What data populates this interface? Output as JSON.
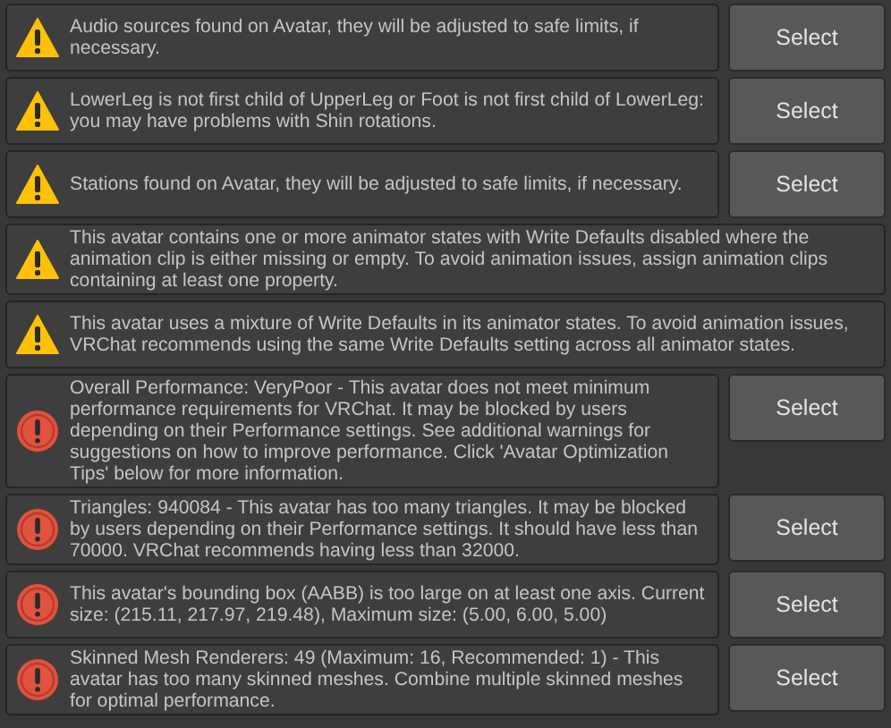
{
  "messages": [
    {
      "kind": "warning",
      "text": "Audio sources found on Avatar, they will be adjusted to safe limits, if necessary.",
      "button": "Select"
    },
    {
      "kind": "warning",
      "text": "LowerLeg is not first child of UpperLeg or Foot is not first child of LowerLeg: you may have problems with Shin rotations.",
      "button": "Select"
    },
    {
      "kind": "warning",
      "text": "Stations found on Avatar, they will be adjusted to safe limits, if necessary.",
      "button": "Select"
    },
    {
      "kind": "warning",
      "text": "This avatar contains one or more animator states with Write Defaults disabled where the animation clip is either missing or empty. To avoid animation issues, assign animation clips containing at least one property."
    },
    {
      "kind": "warning",
      "text": "This avatar uses a mixture of Write Defaults in its animator states. To avoid animation issues, VRChat recommends using the same Write Defaults setting across all animator states."
    },
    {
      "kind": "error",
      "text": "Overall Performance: VeryPoor - This avatar does not meet minimum performance requirements for VRChat. It may be blocked by users depending on their Performance settings. See additional warnings for suggestions on how to improve performance. Click 'Avatar Optimization Tips' below for more information.",
      "button": "Select"
    },
    {
      "kind": "error",
      "text": "Triangles: 940084 - This avatar has too many triangles. It may be blocked by users depending on their Performance settings. It should have less than 70000. VRChat recommends having less than 32000.",
      "button": "Select"
    },
    {
      "kind": "error",
      "text": "This avatar's bounding box (AABB) is too large on at least one axis. Current size: (215.11, 217.97, 219.48), Maximum size: (5.00, 6.00, 5.00)",
      "button": "Select"
    },
    {
      "kind": "error",
      "text": "Skinned Mesh Renderers: 49 (Maximum: 16, Recommended: 1) - This avatar has too many skinned meshes. Combine multiple skinned meshes for optimal performance.",
      "button": "Select"
    }
  ]
}
